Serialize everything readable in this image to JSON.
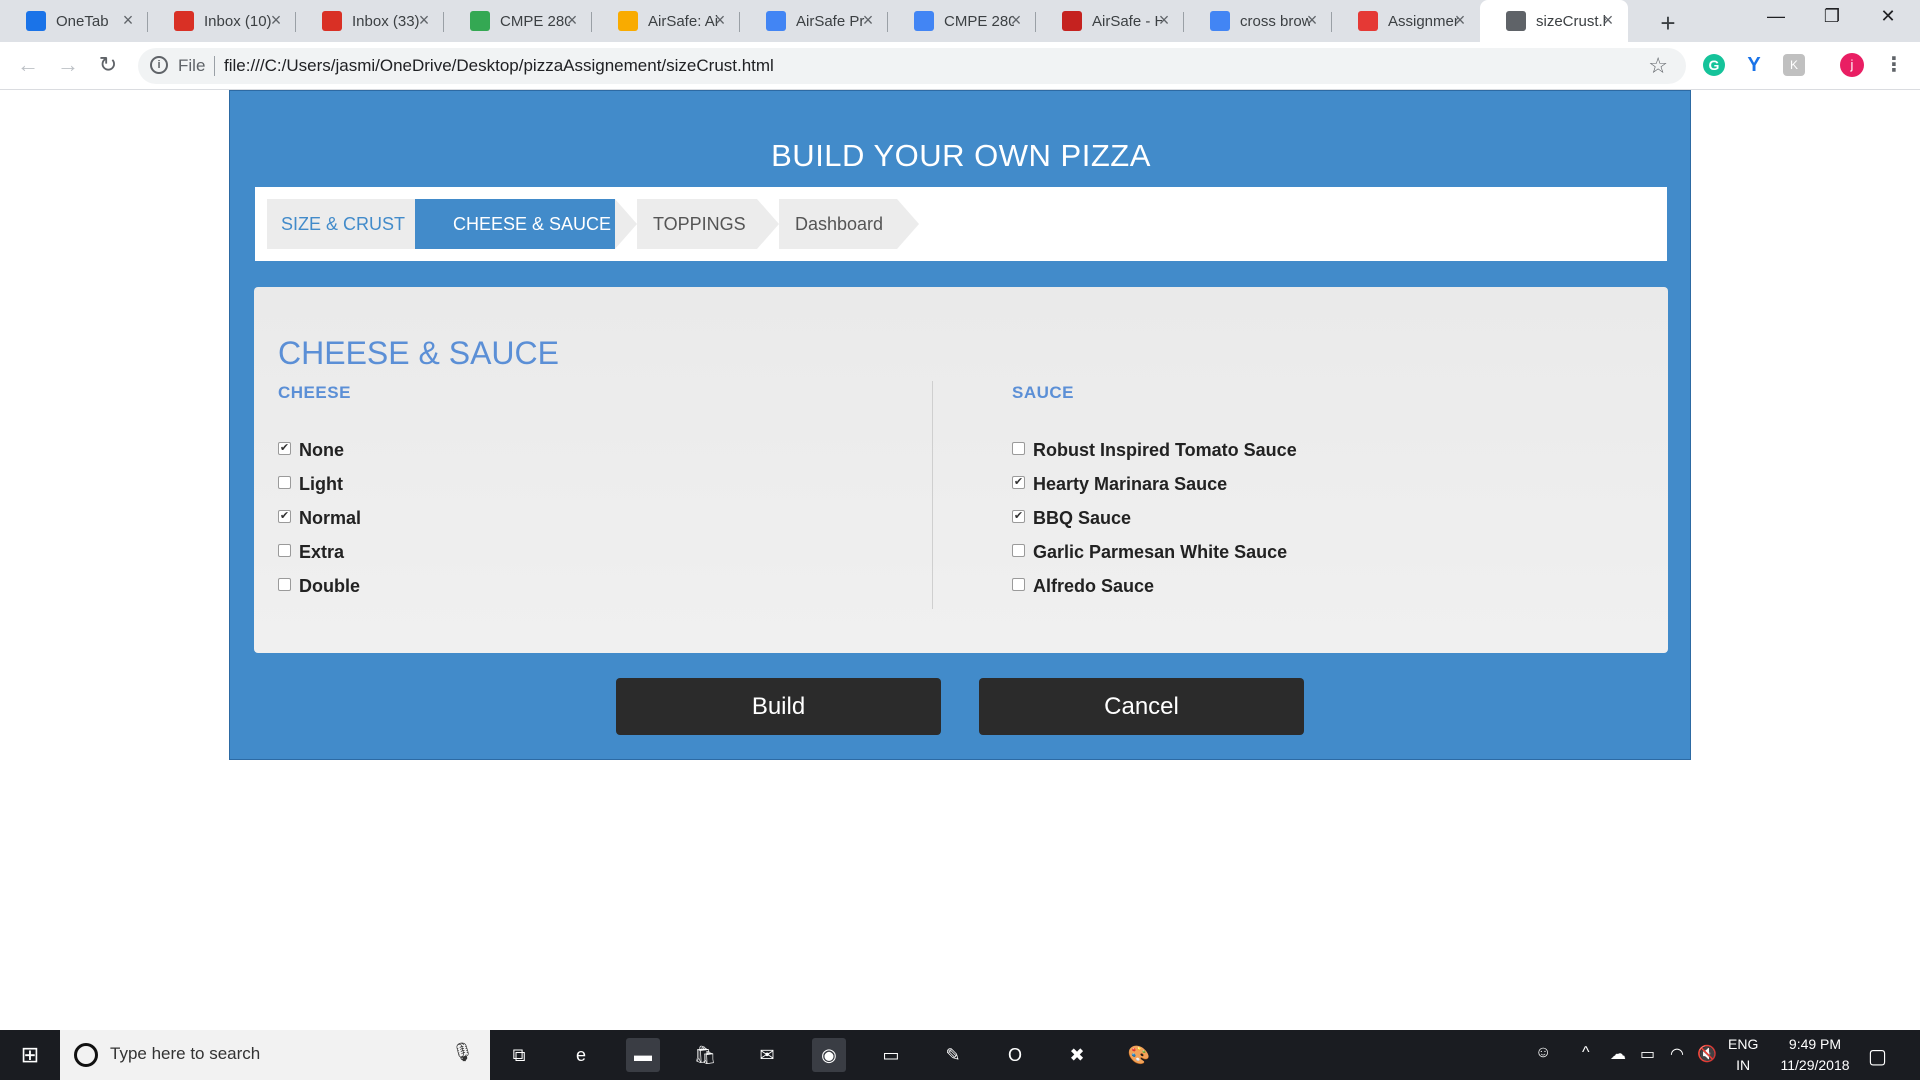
{
  "browser": {
    "tabs": [
      {
        "title": "OneTab",
        "favicon": "onetab-icon",
        "color": "#1a73e8"
      },
      {
        "title": "Inbox (10)",
        "favicon": "gmail-icon",
        "color": "#d93025"
      },
      {
        "title": "Inbox (33)",
        "favicon": "gmail-icon",
        "color": "#d93025"
      },
      {
        "title": "CMPE 280",
        "favicon": "drive-icon",
        "color": "#34a853"
      },
      {
        "title": "AirSafe: Ai",
        "favicon": "slides-icon",
        "color": "#f9ab00"
      },
      {
        "title": "AirSafe Pr",
        "favicon": "docs-icon",
        "color": "#4285f4"
      },
      {
        "title": "CMPE 280",
        "favicon": "docs-icon",
        "color": "#4285f4"
      },
      {
        "title": "AirSafe - H",
        "favicon": "airplane-icon",
        "color": "#c5221f"
      },
      {
        "title": "cross brow",
        "favicon": "google-icon",
        "color": "#4285f4"
      },
      {
        "title": "Assignmen",
        "favicon": "canvas-icon",
        "color": "#e53935"
      },
      {
        "title": "sizeCrust.h",
        "favicon": "file-icon",
        "color": "#5f6368"
      }
    ],
    "active_tab_index": 10,
    "close_glyph": "×",
    "new_tab_glyph": "+",
    "window_controls": {
      "minimize": "—",
      "restore": "❐",
      "close": "✕"
    },
    "nav": {
      "back": "←",
      "forward": "→",
      "reload": "↻"
    },
    "address": {
      "info_glyph": "i",
      "scheme_label": "File",
      "url": "file:///C:/Users/jasmi/OneDrive/Desktop/pizzaAssignement/sizeCrust.html",
      "bookmark_glyph": "☆"
    },
    "extensions": {
      "grammarly": "G",
      "yoast": "Y",
      "ext3": "K"
    },
    "profile_initial": "j",
    "menu_glyph": "⋮"
  },
  "app": {
    "title": "BUILD YOUR OWN PIZZA",
    "steps": [
      {
        "label": "SIZE & CRUST",
        "state": "done"
      },
      {
        "label": "CHEESE & SAUCE",
        "state": "active"
      },
      {
        "label": "TOPPINGS",
        "state": "todo"
      },
      {
        "label": "Dashboard",
        "state": "todo"
      }
    ],
    "panel_title": "CHEESE & SAUCE",
    "cheese": {
      "heading": "CHEESE",
      "options": [
        {
          "label": "None",
          "checked": true
        },
        {
          "label": "Light",
          "checked": false
        },
        {
          "label": "Normal",
          "checked": true
        },
        {
          "label": "Extra",
          "checked": false
        },
        {
          "label": "Double",
          "checked": false
        }
      ]
    },
    "sauce": {
      "heading": "SAUCE",
      "options": [
        {
          "label": "Robust Inspired Tomato Sauce",
          "checked": false
        },
        {
          "label": "Hearty Marinara Sauce",
          "checked": true
        },
        {
          "label": "BBQ Sauce",
          "checked": true
        },
        {
          "label": "Garlic Parmesan White Sauce",
          "checked": false
        },
        {
          "label": "Alfredo Sauce",
          "checked": false
        }
      ]
    },
    "buttons": {
      "build": "Build",
      "cancel": "Cancel"
    },
    "colors": {
      "primary": "#428bca",
      "heading": "#5b8fd6",
      "button": "#2b2b2b"
    }
  },
  "taskbar": {
    "start_glyph": "⊞",
    "search_placeholder": "Type here to search",
    "mic_glyph": "🎙",
    "apps": [
      {
        "name": "task-view-icon",
        "glyph": "⧉",
        "color": "#1a1c21"
      },
      {
        "name": "edge-icon",
        "glyph": "e",
        "color": "#1a1c21"
      },
      {
        "name": "file-explorer-icon",
        "glyph": "▬",
        "color": "#3a3d44"
      },
      {
        "name": "store-icon",
        "glyph": "🛍",
        "color": "#1a1c21"
      },
      {
        "name": "mail-icon",
        "glyph": "✉",
        "color": "#1a1c21"
      },
      {
        "name": "chrome-icon",
        "glyph": "◉",
        "color": "#3a3d44"
      },
      {
        "name": "terminal-icon",
        "glyph": "▭",
        "color": "#1a1c21"
      },
      {
        "name": "notepadpp-icon",
        "glyph": "✎",
        "color": "#1a1c21"
      },
      {
        "name": "outlook-icon",
        "glyph": "O",
        "color": "#1a1c21"
      },
      {
        "name": "xampp-icon",
        "glyph": "✖",
        "color": "#1a1c21"
      },
      {
        "name": "paint-icon",
        "glyph": "🎨",
        "color": "#1a1c21"
      }
    ],
    "tray": {
      "people": "☺",
      "chevron": "^",
      "onedrive": "☁",
      "battery": "▭",
      "wifi": "◠",
      "volume": "🔇",
      "notifications": "▢"
    },
    "language": {
      "code": "ENG",
      "region": "IN"
    },
    "time": "9:49 PM",
    "date": "11/29/2018"
  }
}
